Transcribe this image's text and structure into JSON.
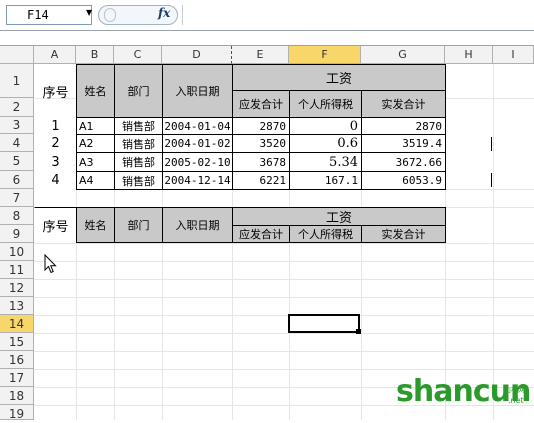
{
  "formula_bar": {
    "name_box": "F14",
    "fx_label": "fx",
    "formula": ""
  },
  "columns": [
    "A",
    "B",
    "C",
    "D",
    "E",
    "F",
    "G",
    "H",
    "I"
  ],
  "rows": [
    "1",
    "2",
    "3",
    "4",
    "5",
    "6",
    "7",
    "8",
    "9",
    "10",
    "11",
    "12",
    "13",
    "14",
    "15",
    "16",
    "17",
    "18",
    "19"
  ],
  "table1": {
    "headers": {
      "seq": "序号",
      "name": "姓名",
      "dept": "部门",
      "hire_date": "入职日期",
      "salary": "工资",
      "gross": "应发合计",
      "tax": "个人所得税",
      "net": "实发合计"
    },
    "rows": [
      {
        "seq": "1",
        "name": "A1",
        "dept": "销售部",
        "hire_date": "2004-01-04",
        "gross": "2870",
        "tax": "0",
        "net": "2870"
      },
      {
        "seq": "2",
        "name": "A2",
        "dept": "销售部",
        "hire_date": "2004-01-02",
        "gross": "3520",
        "tax": "0.6",
        "net": "3519.4"
      },
      {
        "seq": "3",
        "name": "A3",
        "dept": "销售部",
        "hire_date": "2005-02-10",
        "gross": "3678",
        "tax": "5.34",
        "net": "3672.66"
      },
      {
        "seq": "4",
        "name": "A4",
        "dept": "销售部",
        "hire_date": "2004-12-14",
        "gross": "6221",
        "tax": "167.1",
        "net": "6053.9"
      }
    ]
  },
  "table2": {
    "headers": {
      "seq": "序号",
      "name": "姓名",
      "dept": "部门",
      "hire_date": "入职日期",
      "salary": "工资",
      "gross": "应发合计",
      "tax": "个人所得税",
      "net": "实发合计"
    }
  },
  "watermark": {
    "brand": "shancun",
    "suffix_top": "山村网",
    "suffix_bottom": ".net"
  }
}
